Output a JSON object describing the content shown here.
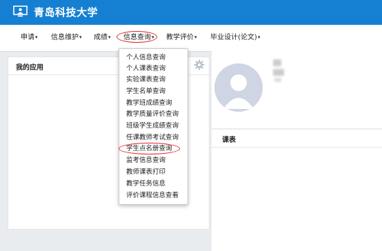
{
  "header": {
    "title": "青岛科技大学",
    "logo_icon": "monitor-user-icon",
    "bg_color": "#1580d2"
  },
  "nav": {
    "items": [
      {
        "label": "申请"
      },
      {
        "label": "信息维护"
      },
      {
        "label": "成绩"
      },
      {
        "label": "信息查询"
      },
      {
        "label": "教学评价"
      },
      {
        "label": "毕业设计(论文)"
      }
    ],
    "caret": "▾",
    "highlight_color": "#e0232b"
  },
  "my_apps": {
    "title": "我的应用",
    "settings_icon": "gear-icon"
  },
  "schedule": {
    "title": "课表"
  },
  "dropdown": {
    "items": [
      {
        "label": "个人信息查询"
      },
      {
        "label": "个人课表查询"
      },
      {
        "label": "实验课表查询"
      },
      {
        "label": "学生名单查询"
      },
      {
        "label": "教学班成绩查询"
      },
      {
        "label": "教学质量评价查询"
      },
      {
        "label": "班级学生成绩查询"
      },
      {
        "label": "任课教师考试查询"
      },
      {
        "label": "学生点名册查询"
      },
      {
        "label": "监考信息查询"
      },
      {
        "label": "教师课表打印"
      },
      {
        "label": "教学任务信息"
      },
      {
        "label": "评价课程信息查看"
      }
    ]
  }
}
